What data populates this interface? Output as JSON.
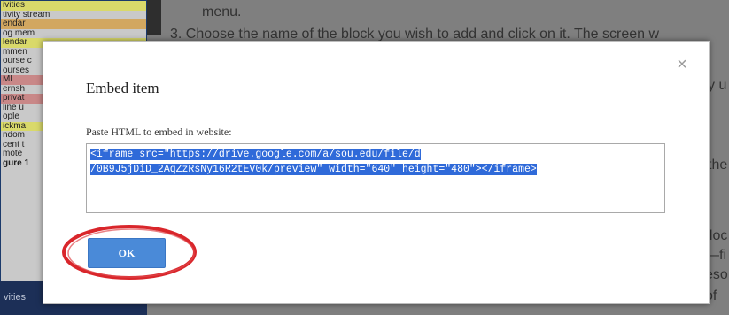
{
  "background": {
    "sidebar_items": [
      {
        "text": "ivities",
        "style": "hl-y"
      },
      {
        "text": "tivity stream",
        "style": ""
      },
      {
        "text": "endar",
        "style": "hl-o"
      },
      {
        "text": "og mem",
        "style": ""
      },
      {
        "text": "lendar",
        "style": "hl-y"
      },
      {
        "text": "mmen",
        "style": ""
      },
      {
        "text": "ourse c",
        "style": ""
      },
      {
        "text": "ourses",
        "style": ""
      },
      {
        "text": "ML",
        "style": "hl-r"
      },
      {
        "text": "ernsh",
        "style": ""
      },
      {
        "text": "privat",
        "style": "hl-r"
      },
      {
        "text": "line u",
        "style": ""
      },
      {
        "text": "ople",
        "style": ""
      },
      {
        "text": "ickma",
        "style": "hl-y"
      },
      {
        "text": "ndom",
        "style": ""
      },
      {
        "text": "cent t",
        "style": ""
      },
      {
        "text": "mote",
        "style": ""
      },
      {
        "text": "gure 1",
        "style": "bold"
      }
    ],
    "bottom_bar_text": "vities",
    "doc_line_1": "menu.",
    "doc_line_2": "3.   Choose the name of the block you wish to add and click on it. The screen w",
    "frag_right_1": "y u",
    "frag_right_2": "the",
    "frag_right_3": "bloc",
    "frag_right_4": "—fi",
    "frag_right_5": "eso",
    "frag_right_6": "of"
  },
  "modal": {
    "title": "Embed item",
    "close_label": "×",
    "field_label": "Paste HTML to embed in website:",
    "embed_line_1": "<iframe src=\"https://drive.google.com/a/sou.edu/file/d",
    "embed_line_2": "/0B9J5jDiD_2AqZzRsNy16R2tEV0k/preview\" width=\"640\" height=\"480\"></iframe>",
    "ok_label": "OK"
  },
  "colors": {
    "overlay": "#7f7f7f",
    "selection": "#2f6ad9",
    "ok_button": "#4a8ad8",
    "annotation_circle": "#d9262b"
  }
}
